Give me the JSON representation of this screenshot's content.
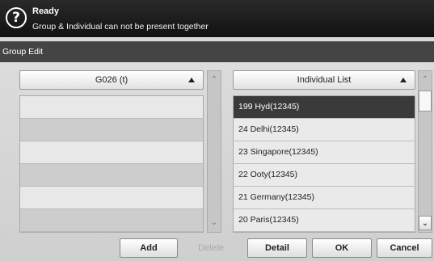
{
  "status": {
    "icon": "question-help-icon",
    "glyph": "?",
    "title": "Ready",
    "message": "Group & Individual can not be present together"
  },
  "title_bar": {
    "title": "Group Edit"
  },
  "group_panel": {
    "header_label": "G026 (t)",
    "sort_icon": "triangle-up-icon",
    "rows": [
      "",
      "",
      "",
      "",
      "",
      ""
    ]
  },
  "individual_panel": {
    "header_label": "Individual List",
    "sort_icon": "triangle-up-icon",
    "items": [
      {
        "label": "199   Hyd(12345)",
        "selected": true
      },
      {
        "label": "24   Delhi(12345)",
        "selected": false
      },
      {
        "label": "23   Singapore(12345)",
        "selected": false
      },
      {
        "label": "22   Ooty(12345)",
        "selected": false
      },
      {
        "label": "21   Germany(12345)",
        "selected": false
      },
      {
        "label": "20   Paris(12345)",
        "selected": false
      }
    ]
  },
  "scroll_glyphs": {
    "up": "⌃",
    "down": "⌄"
  },
  "buttons": {
    "add": "Add",
    "delete": "Delete",
    "detail": "Detail",
    "ok": "OK",
    "cancel": "Cancel"
  },
  "colors": {
    "status_bg": "#1a1a1a",
    "title_bar_bg": "#444444",
    "selected_row": "#3a3a3a"
  }
}
